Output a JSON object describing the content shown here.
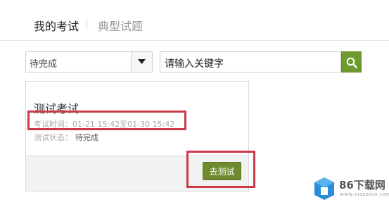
{
  "tabs": {
    "active": "我的考试",
    "inactive": "典型试题"
  },
  "filters": {
    "status_value": "待完成",
    "search_placeholder": "请输入关键字"
  },
  "exam_card": {
    "title": "测试考试",
    "time_label": "考试时间：",
    "time_value": "01-21 15:42至01-30 15:42",
    "status_label": "测试状态：",
    "status_value": "待完成",
    "action_label": "去测试"
  },
  "watermark": {
    "text": "86下载网",
    "sub": "www.xiazaiba.com"
  },
  "colors": {
    "accent_green": "#6e9a2f",
    "button_green": "#6f8b2e",
    "highlight_red": "#cc3a4a"
  },
  "icons": {
    "select": "caret-down-icon",
    "search": "search-icon",
    "watermark": "box-logo-icon"
  }
}
